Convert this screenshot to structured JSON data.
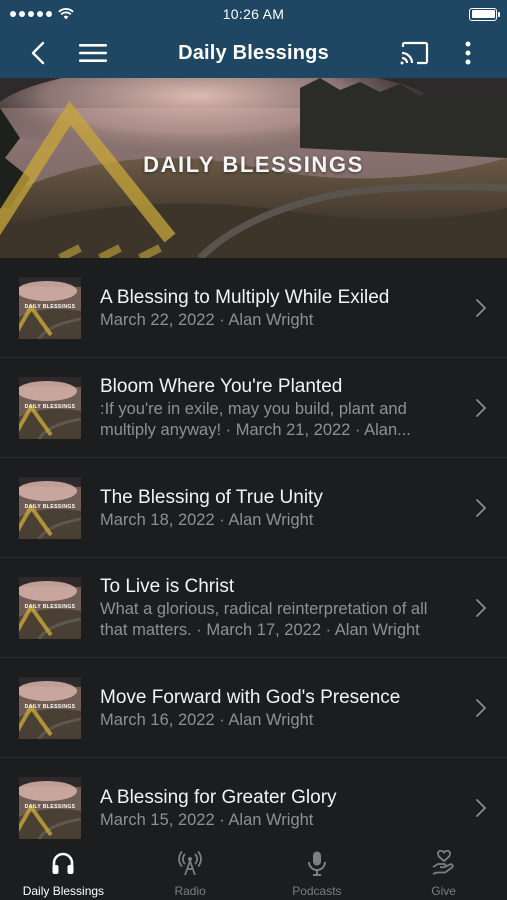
{
  "status_bar": {
    "time": "10:26 AM",
    "signal_icon": "signal-dots-icon",
    "wifi_icon": "wifi-icon",
    "battery_icon": "battery-icon",
    "battery_level": 1.0
  },
  "nav": {
    "title": "Daily Blessings",
    "back_icon": "chevron-left-icon",
    "menu_icon": "hamburger-menu-icon",
    "cast_icon": "cast-icon",
    "more_icon": "vertical-dots-icon"
  },
  "banner": {
    "title": "DAILY BLESSINGS"
  },
  "thumbnail_label": "DAILY BLESSINGS",
  "episodes": [
    {
      "title": "A Blessing to Multiply While Exiled",
      "subtitle": "March 22, 2022 · Alan Wright"
    },
    {
      "title": "Bloom Where You're Planted",
      "subtitle": ":If you're in exile, may you build, plant and multiply anyway! · March 21, 2022 · Alan..."
    },
    {
      "title": "The Blessing of True Unity",
      "subtitle": "March 18, 2022 · Alan Wright"
    },
    {
      "title": "To Live is Christ",
      "subtitle": "What a glorious, radical reinterpretation of all that matters. · March 17, 2022 · Alan Wright"
    },
    {
      "title": "Move Forward with God's Presence",
      "subtitle": "March 16, 2022 · Alan Wright"
    },
    {
      "title": "A Blessing for Greater Glory",
      "subtitle": "March 15, 2022 · Alan Wright"
    }
  ],
  "tabs": [
    {
      "label": "Daily Blessings",
      "icon": "headphones-icon",
      "active": true
    },
    {
      "label": "Radio",
      "icon": "radio-tower-icon",
      "active": false
    },
    {
      "label": "Podcasts",
      "icon": "microphone-icon",
      "active": false
    },
    {
      "label": "Give",
      "icon": "giving-hand-heart-icon",
      "active": false
    }
  ],
  "colors": {
    "nav_background": "#1f4663",
    "page_background": "#1c1d1f",
    "title_text": "#f3f3f3",
    "secondary_text": "#8e9094",
    "inactive_tab": "#7c7e82",
    "brand_gold": "#c8a73a"
  }
}
